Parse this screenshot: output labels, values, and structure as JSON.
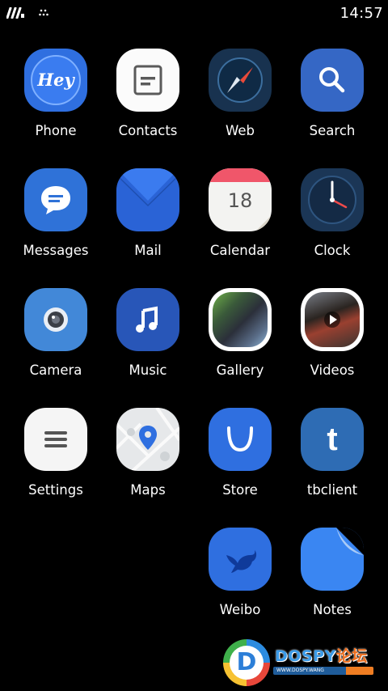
{
  "status_bar": {
    "time": "14:57"
  },
  "apps": [
    {
      "label": "Phone",
      "icon": "hey-icon",
      "badge_text": "Hey"
    },
    {
      "label": "Contacts",
      "icon": "contacts-icon"
    },
    {
      "label": "Web",
      "icon": "compass-icon"
    },
    {
      "label": "Search",
      "icon": "search-icon"
    },
    {
      "label": "Messages",
      "icon": "chat-bubble-icon"
    },
    {
      "label": "Mail",
      "icon": "envelope-icon"
    },
    {
      "label": "Calendar",
      "icon": "calendar-icon",
      "day": "18"
    },
    {
      "label": "Clock",
      "icon": "clock-icon"
    },
    {
      "label": "Camera",
      "icon": "camera-lens-icon"
    },
    {
      "label": "Music",
      "icon": "music-note-icon"
    },
    {
      "label": "Gallery",
      "icon": "gallery-thumbnail-icon"
    },
    {
      "label": "Videos",
      "icon": "video-play-icon"
    },
    {
      "label": "Settings",
      "icon": "menu-lines-icon"
    },
    {
      "label": "Maps",
      "icon": "map-pin-icon"
    },
    {
      "label": "Store",
      "icon": "store-bag-icon"
    },
    {
      "label": "tbclient",
      "icon": "tumblr-t-icon",
      "letter": "t"
    },
    {
      "label": "Weibo",
      "icon": "bird-icon"
    },
    {
      "label": "Notes",
      "icon": "note-page-icon"
    }
  ],
  "watermark": {
    "letter": "D",
    "title_latin": "DOSPY",
    "title_cn": "论坛",
    "url": "WWW.DOSPY.WANG"
  }
}
